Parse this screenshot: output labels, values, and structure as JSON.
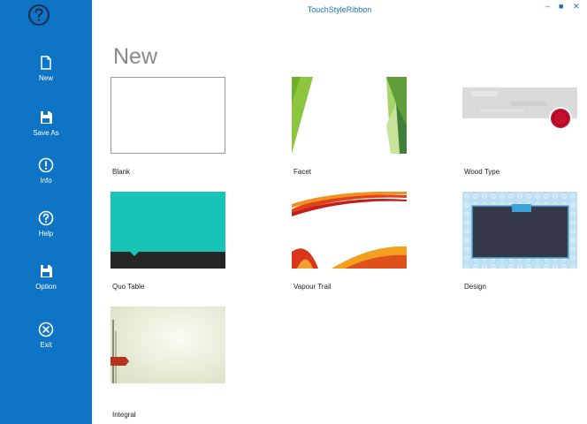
{
  "window": {
    "title": "TouchStyleRibbon",
    "minimize": "–",
    "maximize": "■",
    "close": "✕"
  },
  "nav": {
    "help_icon": "question-circle-icon",
    "items": [
      {
        "label": "New",
        "icon": "new-document-icon"
      },
      {
        "label": "Save As",
        "icon": "save-icon"
      },
      {
        "label": "Info",
        "icon": "info-icon"
      },
      {
        "label": "Help",
        "icon": "help-icon"
      },
      {
        "label": "Option",
        "icon": "option-save-icon"
      },
      {
        "label": "Exit",
        "icon": "exit-icon"
      }
    ]
  },
  "page": {
    "title": "New"
  },
  "templates": [
    {
      "name": "Blank"
    },
    {
      "name": "Facet"
    },
    {
      "name": "Wood Type"
    },
    {
      "name": "Quo Table"
    },
    {
      "name": "Vapour Trail"
    },
    {
      "name": "Design"
    },
    {
      "name": "Integral"
    }
  ],
  "colors": {
    "nav_bg": "#0e74c6",
    "accent": "#1f6fb8",
    "facet_green": "#8cc63f",
    "quo_teal": "#17c4b6",
    "wood_red": "#c8102e"
  }
}
